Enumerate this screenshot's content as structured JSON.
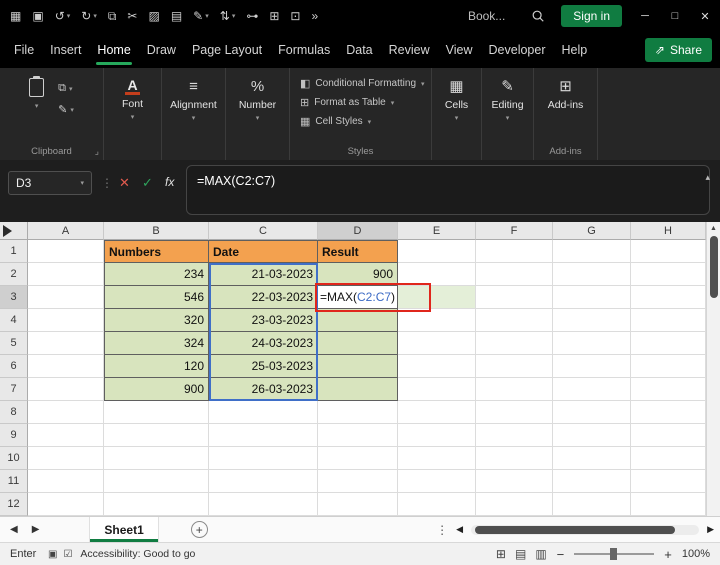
{
  "titlebar": {
    "doc_title": "Book...",
    "signin_label": "Sign in",
    "icons": [
      {
        "name": "workbook-grid-icon",
        "glyph": "▦"
      },
      {
        "name": "save-icon",
        "glyph": "▣"
      },
      {
        "name": "undo-icon",
        "glyph": "↺",
        "caret": true
      },
      {
        "name": "redo-icon",
        "glyph": "↻",
        "caret": true
      },
      {
        "name": "copy-icon",
        "glyph": "⧉"
      },
      {
        "name": "cut-icon",
        "glyph": "✂"
      },
      {
        "name": "picture-icon",
        "glyph": "▨"
      },
      {
        "name": "print-icon",
        "glyph": "▤"
      },
      {
        "name": "format-painter-icon",
        "glyph": "✎",
        "caret": true
      },
      {
        "name": "sort-icon",
        "glyph": "⇅",
        "caret": true
      },
      {
        "name": "link-icon",
        "glyph": "⊶"
      },
      {
        "name": "table-icon",
        "glyph": "⊞"
      },
      {
        "name": "camera-icon",
        "glyph": "⊡"
      },
      {
        "name": "overflow-icon",
        "glyph": "»"
      }
    ],
    "window": {
      "minimize": "─",
      "maximize": "□",
      "close": "✕"
    }
  },
  "menu": {
    "items": [
      "File",
      "Insert",
      "Home",
      "Draw",
      "Page Layout",
      "Formulas",
      "Data",
      "Review",
      "View",
      "Developer",
      "Help"
    ],
    "active_index": 2,
    "share_label": "Share",
    "share_icon": "⇗"
  },
  "ribbon": {
    "clipboard_label": "Clipboard",
    "copy_glyph": "⧉",
    "painter_glyph": "✎",
    "font_label": "Font",
    "font_icon": "A",
    "alignment_label": "Alignment",
    "alignment_icon": "≡",
    "number_label": "Number",
    "number_icon": "%",
    "styles_label": "Styles",
    "styles_items": [
      {
        "icon": "◧",
        "label": "Conditional Formatting"
      },
      {
        "icon": "⊞",
        "label": "Format as Table"
      },
      {
        "icon": "▦",
        "label": "Cell Styles"
      }
    ],
    "cells_label": "Cells",
    "cells_icon": "▦",
    "editing_label": "Editing",
    "editing_icon": "✎",
    "addins_label": "Add-ins",
    "addins_icon": "⊞",
    "addins_group_label": "Add-ins"
  },
  "formula_bar": {
    "name_box": "D3",
    "formula": "=MAX(C2:C7)"
  },
  "grid": {
    "col_headers": [
      "A",
      "B",
      "C",
      "D",
      "E",
      "F",
      "G",
      "H"
    ],
    "active_col": "D",
    "active_row": "3",
    "row_count": 12,
    "table": {
      "headers": [
        "Numbers",
        "Date",
        "Result"
      ],
      "rows": [
        [
          "234",
          "21-03-2023",
          "900"
        ],
        [
          "546",
          "22-03-2023",
          ""
        ],
        [
          "320",
          "23-03-2023",
          ""
        ],
        [
          "324",
          "24-03-2023",
          ""
        ],
        [
          "120",
          "25-03-2023",
          ""
        ],
        [
          "900",
          "26-03-2023",
          ""
        ]
      ]
    },
    "active_cell": {
      "ref": "D3",
      "pre": "=MAX(",
      "range": "C2:C7",
      "post": ")"
    },
    "colors": {
      "header_fill": "#F3A14F",
      "data_fill": "#D8E4BE",
      "range_border": "#3F6FC8",
      "annotation_border": "#E0261C",
      "e3_fill": "#E4EFD8"
    }
  },
  "sheet_bar": {
    "tab": "Sheet1",
    "add": "+"
  },
  "status_bar": {
    "mode": "Enter",
    "macro_icon": "▣",
    "accessibility_icon": "☑",
    "accessibility": "Accessibility: Good to go",
    "view_icons": [
      "⊞",
      "▤",
      "▥"
    ],
    "zoom": "100%"
  },
  "ui": {
    "caret": "▾",
    "collapse": "▴",
    "dots": "⋮",
    "cancel": "✕",
    "check": "✓",
    "fx": "fx",
    "launcher": "⌟",
    "nav_left": "◀",
    "nav_right": "▶",
    "minus": "−",
    "plus": "+",
    "scroll_up": "▲",
    "scroll_left": "◀",
    "scroll_right": "▶"
  }
}
